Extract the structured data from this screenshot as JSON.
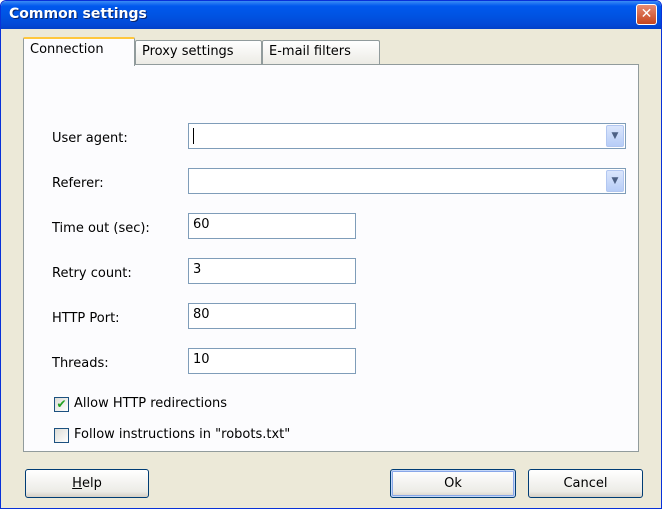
{
  "window": {
    "title": "Common settings",
    "close_glyph": "✕"
  },
  "tabs": [
    {
      "label": "Connection",
      "active": true
    },
    {
      "label": "Proxy settings",
      "active": false
    },
    {
      "label": "E-mail filters",
      "active": false
    }
  ],
  "connection": {
    "user_agent": {
      "label": "User agent:",
      "value": ""
    },
    "referer": {
      "label": "Referer:",
      "value": ""
    },
    "timeout": {
      "label": "Time out (sec):",
      "value": "60"
    },
    "retry_count": {
      "label": "Retry count:",
      "value": "3"
    },
    "http_port": {
      "label": "HTTP Port:",
      "value": "80"
    },
    "threads": {
      "label": "Threads:",
      "value": "10"
    },
    "allow_redirects": {
      "label": "Allow HTTP redirections",
      "checked": true
    },
    "follow_robots": {
      "label": "Follow instructions in \"robots.txt\"",
      "checked": false
    }
  },
  "buttons": {
    "help": {
      "mnemonic": "H",
      "rest": "elp"
    },
    "ok": "Ok",
    "cancel": "Cancel"
  },
  "icons": {
    "dropdown": "chevron-down-icon",
    "check": "checkmark-icon",
    "close": "close-icon"
  },
  "colors": {
    "titlebar": "#0054e3",
    "dialog_bg": "#ece9d8",
    "panel_bg": "#fcfcfe",
    "tab_highlight": "#ffc73c",
    "check": "#21a121"
  }
}
